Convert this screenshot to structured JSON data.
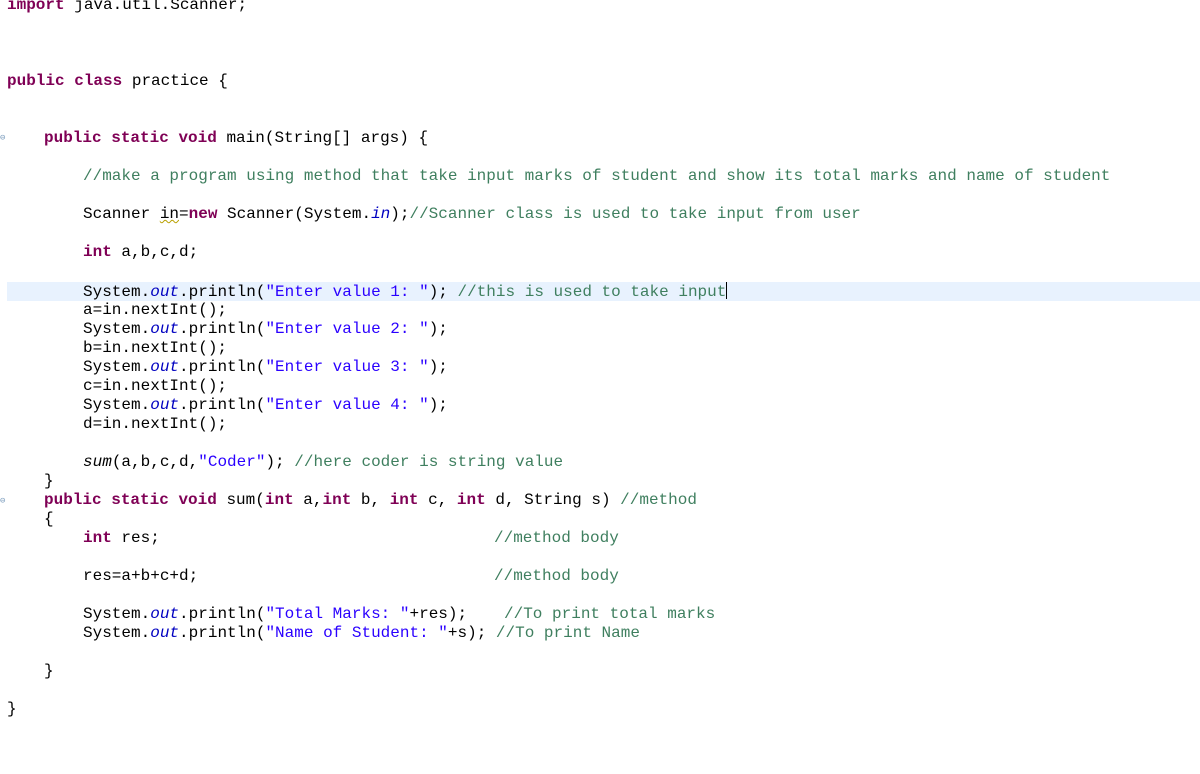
{
  "editor": {
    "lines": {
      "l1": {
        "kw": "import",
        "rest": " java.util.Scanner;"
      },
      "l2": {
        "kw1": "public",
        "kw2": "class",
        "rest": " practice {"
      },
      "l3": {
        "kw1": "public",
        "kw2": "static",
        "kw3": "void",
        "rest": " main(String[] args) {"
      },
      "l4": {
        "comment": "//make a program using method that take input marks of student and show its total marks and name of student"
      },
      "l5": {
        "pre": "Scanner ",
        "warn": "in",
        "eq": "=",
        "kw": "new",
        "mid": " Scanner(System.",
        "fld": "in",
        "post": ");",
        "comment": "//Scanner class is used to take input from user"
      },
      "l6": {
        "kw": "int",
        "rest": " a,b,c,d;"
      },
      "l7": {
        "pre": "System.",
        "fld": "out",
        "mid": ".println(",
        "str": "\"Enter value 1: \"",
        "post": "); ",
        "comment": "//this is used to take input"
      },
      "l8": {
        "text": "a=in.nextInt();"
      },
      "l9": {
        "pre": "System.",
        "fld": "out",
        "mid": ".println(",
        "str": "\"Enter value 2: \"",
        "post": ");"
      },
      "l10": {
        "text": "b=in.nextInt();"
      },
      "l11": {
        "pre": "System.",
        "fld": "out",
        "mid": ".println(",
        "str": "\"Enter value 3: \"",
        "post": ");"
      },
      "l12": {
        "text": "c=in.nextInt();"
      },
      "l13": {
        "pre": "System.",
        "fld": "out",
        "mid": ".println(",
        "str": "\"Enter value 4: \"",
        "post": ");"
      },
      "l14": {
        "text": "d=in.nextInt();"
      },
      "l15": {
        "mth": "sum",
        "mid": "(a,b,c,d,",
        "str": "\"Coder\"",
        "post": "); ",
        "comment": "//here coder is string value"
      },
      "l16": {
        "text": "}"
      },
      "l17": {
        "kw1": "public",
        "kw2": "static",
        "kw3": "void",
        "p1": " sum(",
        "kw4": "int",
        "p2": " a,",
        "kw5": "int",
        "p3": " b, ",
        "kw6": "int",
        "p4": " c, ",
        "kw7": "int",
        "p5": " d, String s) ",
        "comment": "//method"
      },
      "l18": {
        "text": "{"
      },
      "l19": {
        "kw": "int",
        "rest": " res;",
        "comment": "//method body"
      },
      "l20": {
        "text": "res=a+b+c+d;",
        "comment": "//method body"
      },
      "l21": {
        "pre": "System.",
        "fld": "out",
        "mid": ".println(",
        "str": "\"Total Marks: \"",
        "post": "+res);",
        "comment": "//To print total marks"
      },
      "l22": {
        "pre": "System.",
        "fld": "out",
        "mid": ".println(",
        "str": "\"Name of Student: \"",
        "post": "+s); ",
        "comment": "//To print Name"
      },
      "l23": {
        "text": "}"
      },
      "l24": {
        "text": "}"
      }
    },
    "colors": {
      "keyword": "#7f0055",
      "comment": "#3f7f5f",
      "string": "#2a00ff",
      "field": "#0000c0",
      "current_line": "#e8f2fe"
    }
  }
}
